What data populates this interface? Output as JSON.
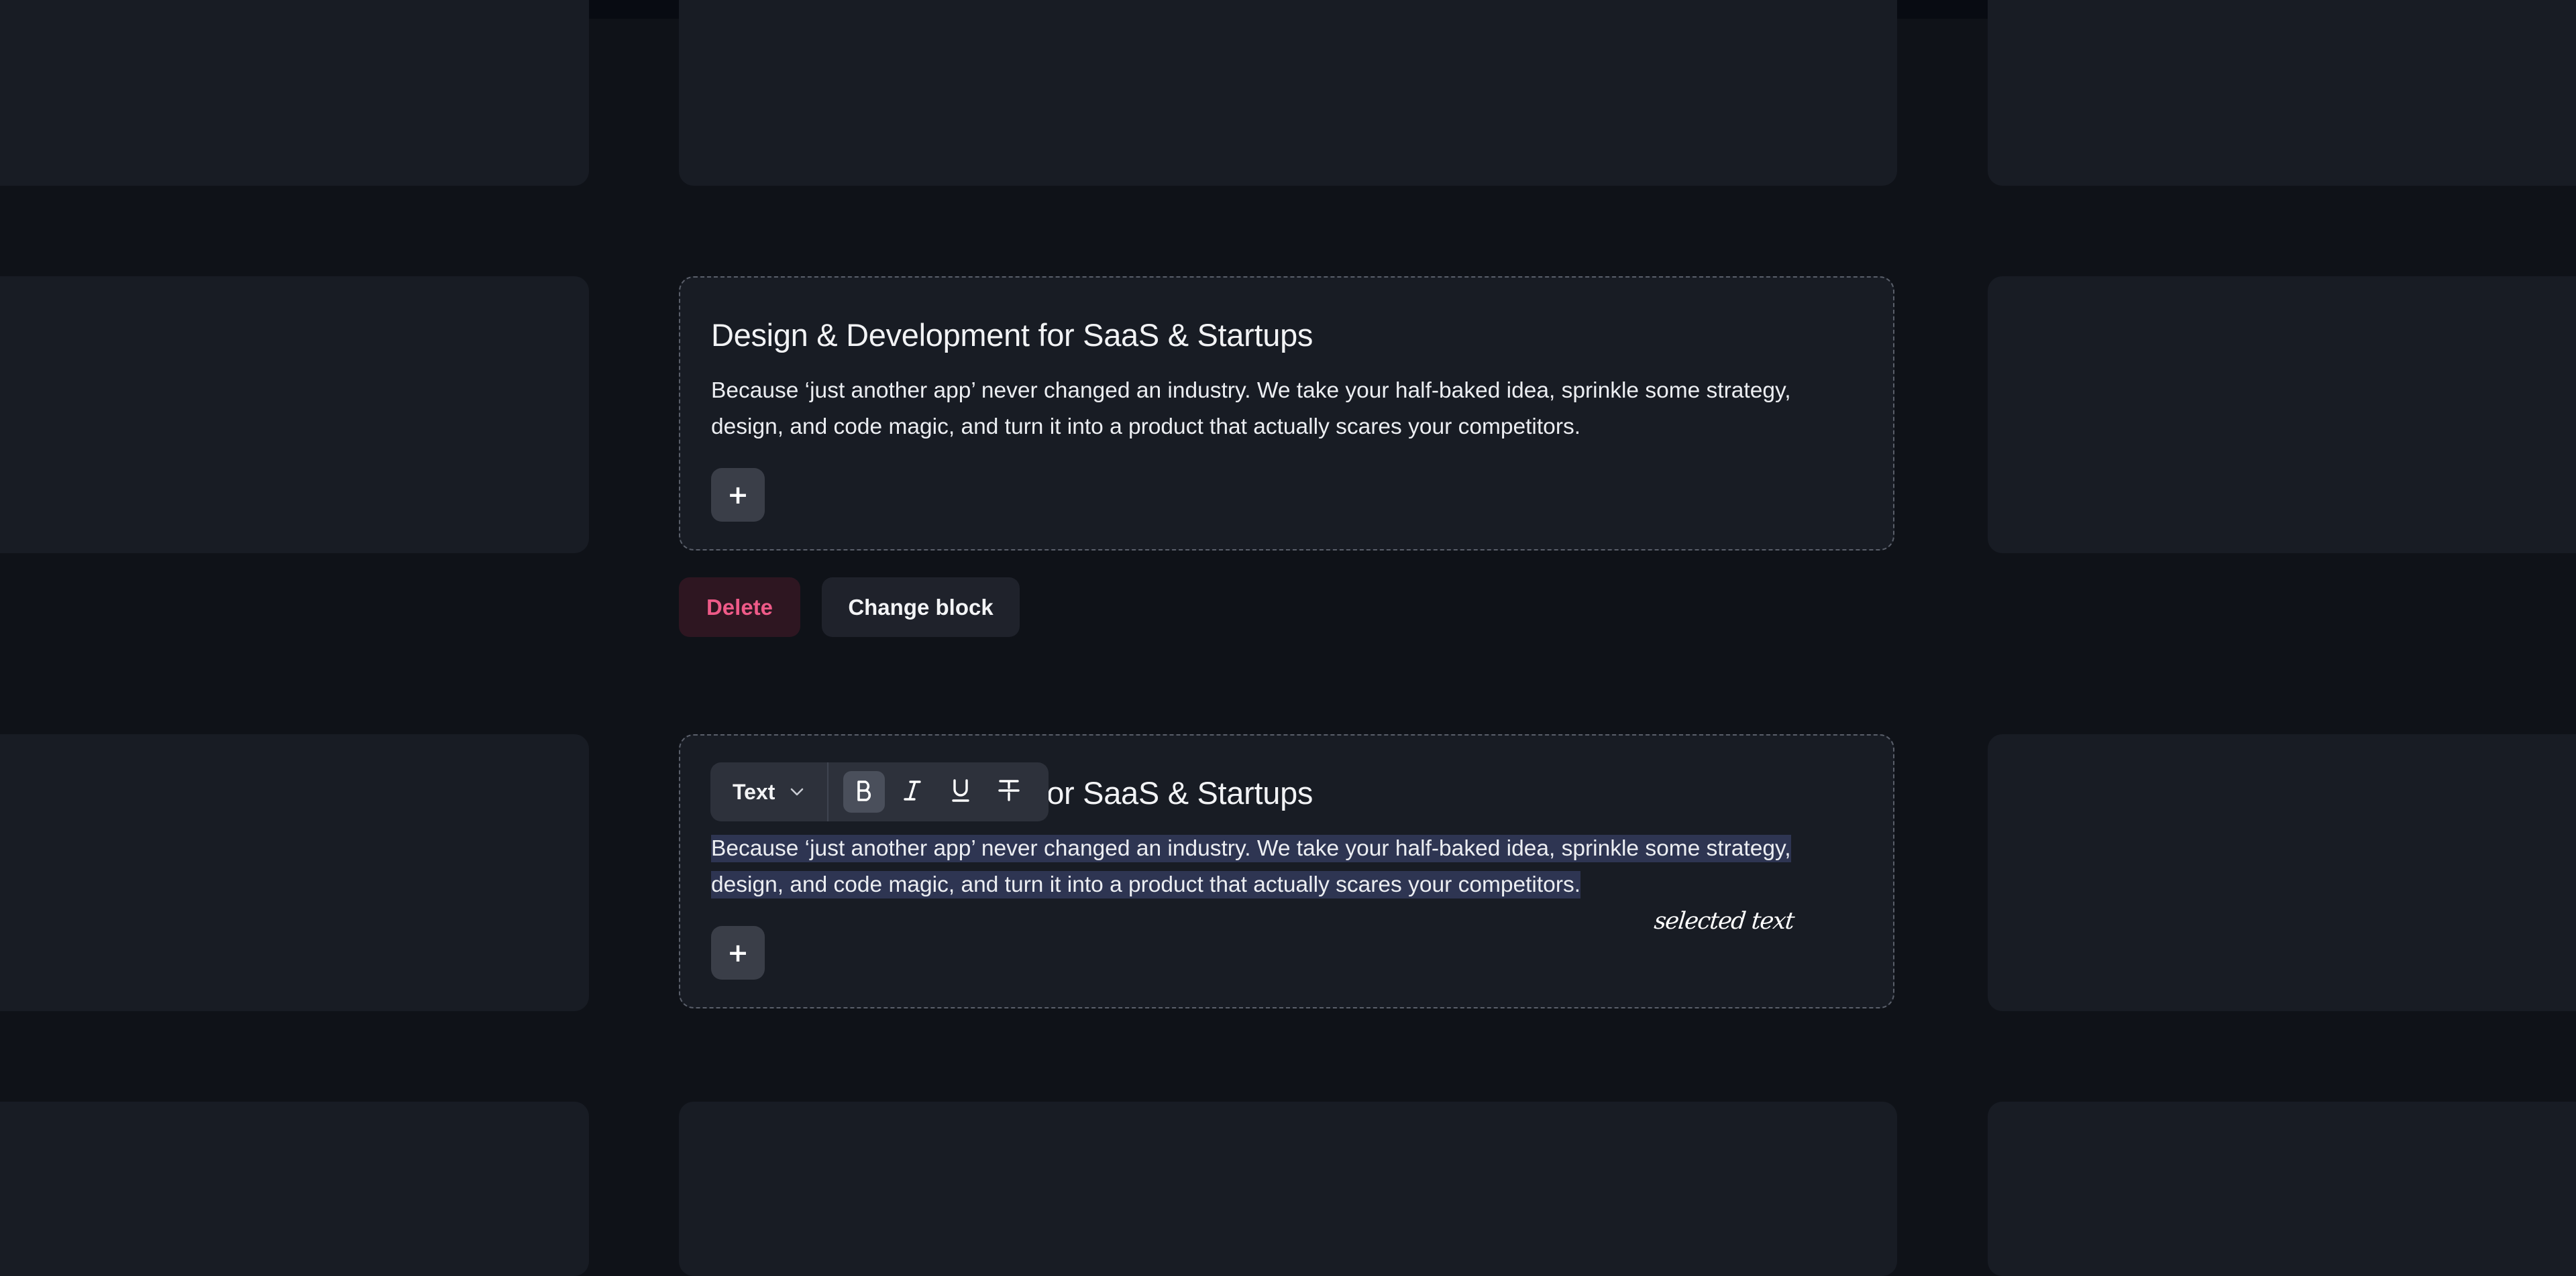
{
  "blocks": [
    {
      "title": "Design & Development for SaaS & Startups",
      "body": "Because ‘just another app’ never changed an industry. We take your half-baked idea, sprinkle some strategy, design, and code magic, and turn it into a product that actually scares your competitors.",
      "add_label": "+"
    },
    {
      "title": "Design & Development for SaaS & Startups",
      "body": "Because ‘just another app’ never changed an industry. We take your half-baked idea, sprinkle some strategy, design, and code magic, and turn it into a product that actually scares your competitors.",
      "add_label": "+"
    }
  ],
  "actions": {
    "delete_label": "Delete",
    "change_label": "Change block"
  },
  "toolbar": {
    "type_label": "Text",
    "buttons": [
      {
        "icon": "bold-icon",
        "active": true
      },
      {
        "icon": "italic-icon",
        "active": false
      },
      {
        "icon": "underline-icon",
        "active": false
      },
      {
        "icon": "strikethrough-icon",
        "active": false
      }
    ]
  },
  "annotation": "selected text",
  "colors": {
    "background": "#0f1218",
    "card": "#181c24",
    "dashed_border": "#5a5f6a",
    "delete_text": "#ee5a88",
    "delete_bg": "#2e1621",
    "selection": "#2e3552",
    "toolbar_bg": "#2d313b"
  }
}
